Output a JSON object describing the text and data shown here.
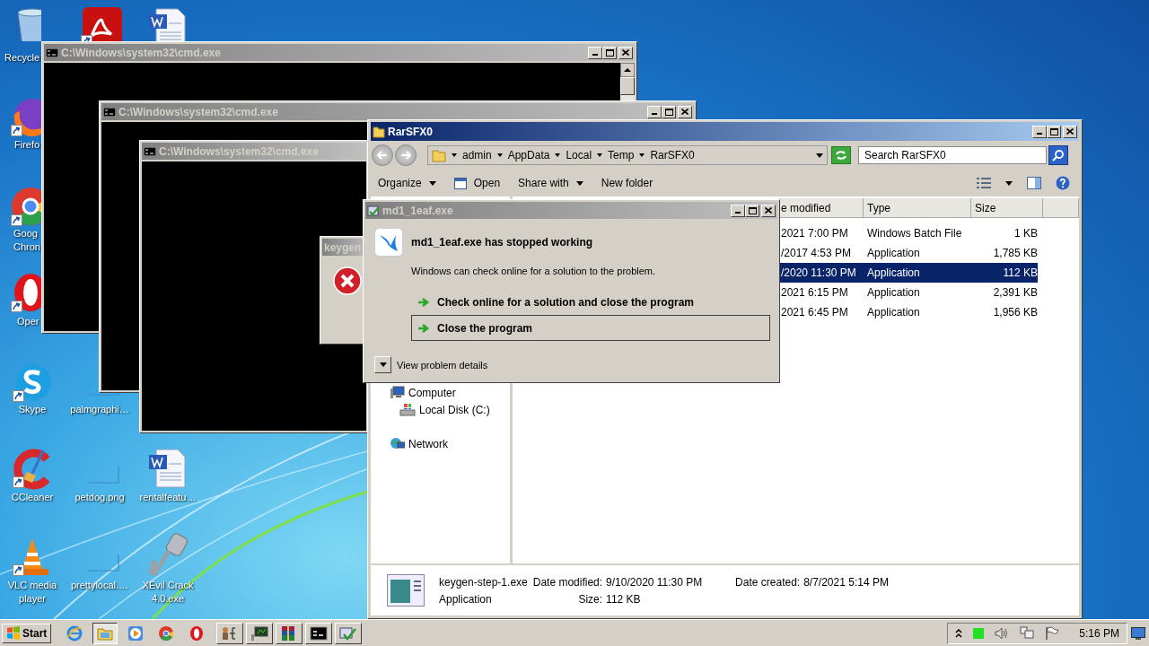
{
  "desktop_icons": [
    {
      "kind": "recycle",
      "label": "Recycle",
      "shortcut": false
    },
    {
      "kind": "pdf",
      "shortcut": true
    },
    {
      "kind": "word",
      "shortcut": false
    },
    {
      "kind": "firefox",
      "label": "Firefo",
      "shortcut": true
    },
    {
      "kind": "chrome",
      "label": "Goog Chron",
      "shortcut": true
    },
    {
      "kind": "opera",
      "label": "Oper",
      "shortcut": true
    },
    {
      "kind": "skype",
      "label": "Skype",
      "shortcut": true
    },
    {
      "kind": "blank",
      "label": "palmgraphi…",
      "shortcut": false
    },
    {
      "kind": "ccleaner",
      "label": "CCleaner",
      "shortcut": true
    },
    {
      "kind": "blank",
      "label": "petdog.png",
      "shortcut": false
    },
    {
      "kind": "word",
      "label": "rentalfeatu…",
      "shortcut": false
    },
    {
      "kind": "vlc",
      "label": "VLC media player",
      "shortcut": true
    },
    {
      "kind": "blank",
      "label": "prettylocal.…",
      "shortcut": false
    },
    {
      "kind": "key",
      "label": "XEvil Crack 4.0.exe",
      "shortcut": false
    }
  ],
  "console_windows": [
    {
      "title": "C:\\Windows\\system32\\cmd.exe",
      "active": false
    },
    {
      "title": "C:\\Windows\\system32\\cmd.exe",
      "active": false
    },
    {
      "title": "C:\\Windows\\system32\\cmd.exe",
      "active": false
    }
  ],
  "keygen_dialog": {
    "title": "keygen"
  },
  "explorer": {
    "title": "RarSFX0",
    "active": true,
    "breadcrumb": [
      "admin",
      "AppData",
      "Local",
      "Temp",
      "RarSFX0"
    ],
    "search": {
      "placeholder": "Search RarSFX0"
    },
    "toolbar": [
      {
        "label": "Organize",
        "kind": "menu"
      },
      {
        "label": "Open",
        "kind": "open"
      },
      {
        "label": "Share with",
        "kind": "menu"
      },
      {
        "label": "New folder",
        "kind": "plain"
      }
    ],
    "columns": [
      "e modified",
      "Type",
      "Size"
    ],
    "rows": [
      {
        "date": "2021 7:00 PM",
        "type": "Windows Batch File",
        "size": "1 KB",
        "selected": false
      },
      {
        "date": "/2017 4:53 PM",
        "type": "Application",
        "size": "1,785 KB",
        "selected": false
      },
      {
        "date": "/2020 11:30 PM",
        "type": "Application",
        "size": "112 KB",
        "selected": true
      },
      {
        "date": "2021 6:15 PM",
        "type": "Application",
        "size": "2,391 KB",
        "selected": false
      },
      {
        "date": "2021 6:45 PM",
        "type": "Application",
        "size": "1,956 KB",
        "selected": false
      }
    ],
    "nav": [
      {
        "label": "Computer",
        "kind": "computer",
        "children": [
          {
            "label": "Local Disk (C:)",
            "kind": "disk"
          }
        ]
      },
      {
        "label": "Network",
        "kind": "network"
      }
    ],
    "details": {
      "name": "keygen-step-1.exe",
      "type": "Application",
      "fields": [
        {
          "label": "Date modified:",
          "value": "9/10/2020 11:30 PM"
        },
        {
          "label": "Date created:",
          "value": "8/7/2021 5:14 PM"
        },
        {
          "label": "Size:",
          "value": "112 KB"
        }
      ]
    }
  },
  "error_dialog": {
    "title": "md1_1eaf.exe",
    "active": false,
    "heading": "md1_1eaf.exe has stopped working",
    "message": "Windows can check online for a solution to the problem.",
    "options": [
      {
        "label": "Check online for a solution and close the program",
        "selected": false
      },
      {
        "label": "Close the program",
        "selected": true
      }
    ],
    "details_toggle": "View problem details"
  },
  "taskbar": {
    "start": "Start",
    "quick_launch": [
      {
        "kind": "ie",
        "selected": false
      },
      {
        "kind": "folder",
        "selected": true
      },
      {
        "kind": "media",
        "selected": false
      },
      {
        "kind": "chrome",
        "selected": false
      },
      {
        "kind": "opera",
        "selected": false
      }
    ],
    "tasks": [
      {
        "kind": "tree"
      },
      {
        "kind": "monitor"
      },
      {
        "kind": "archive"
      },
      {
        "kind": "console"
      },
      {
        "kind": "dialog"
      }
    ],
    "clock": "5:16 PM"
  }
}
